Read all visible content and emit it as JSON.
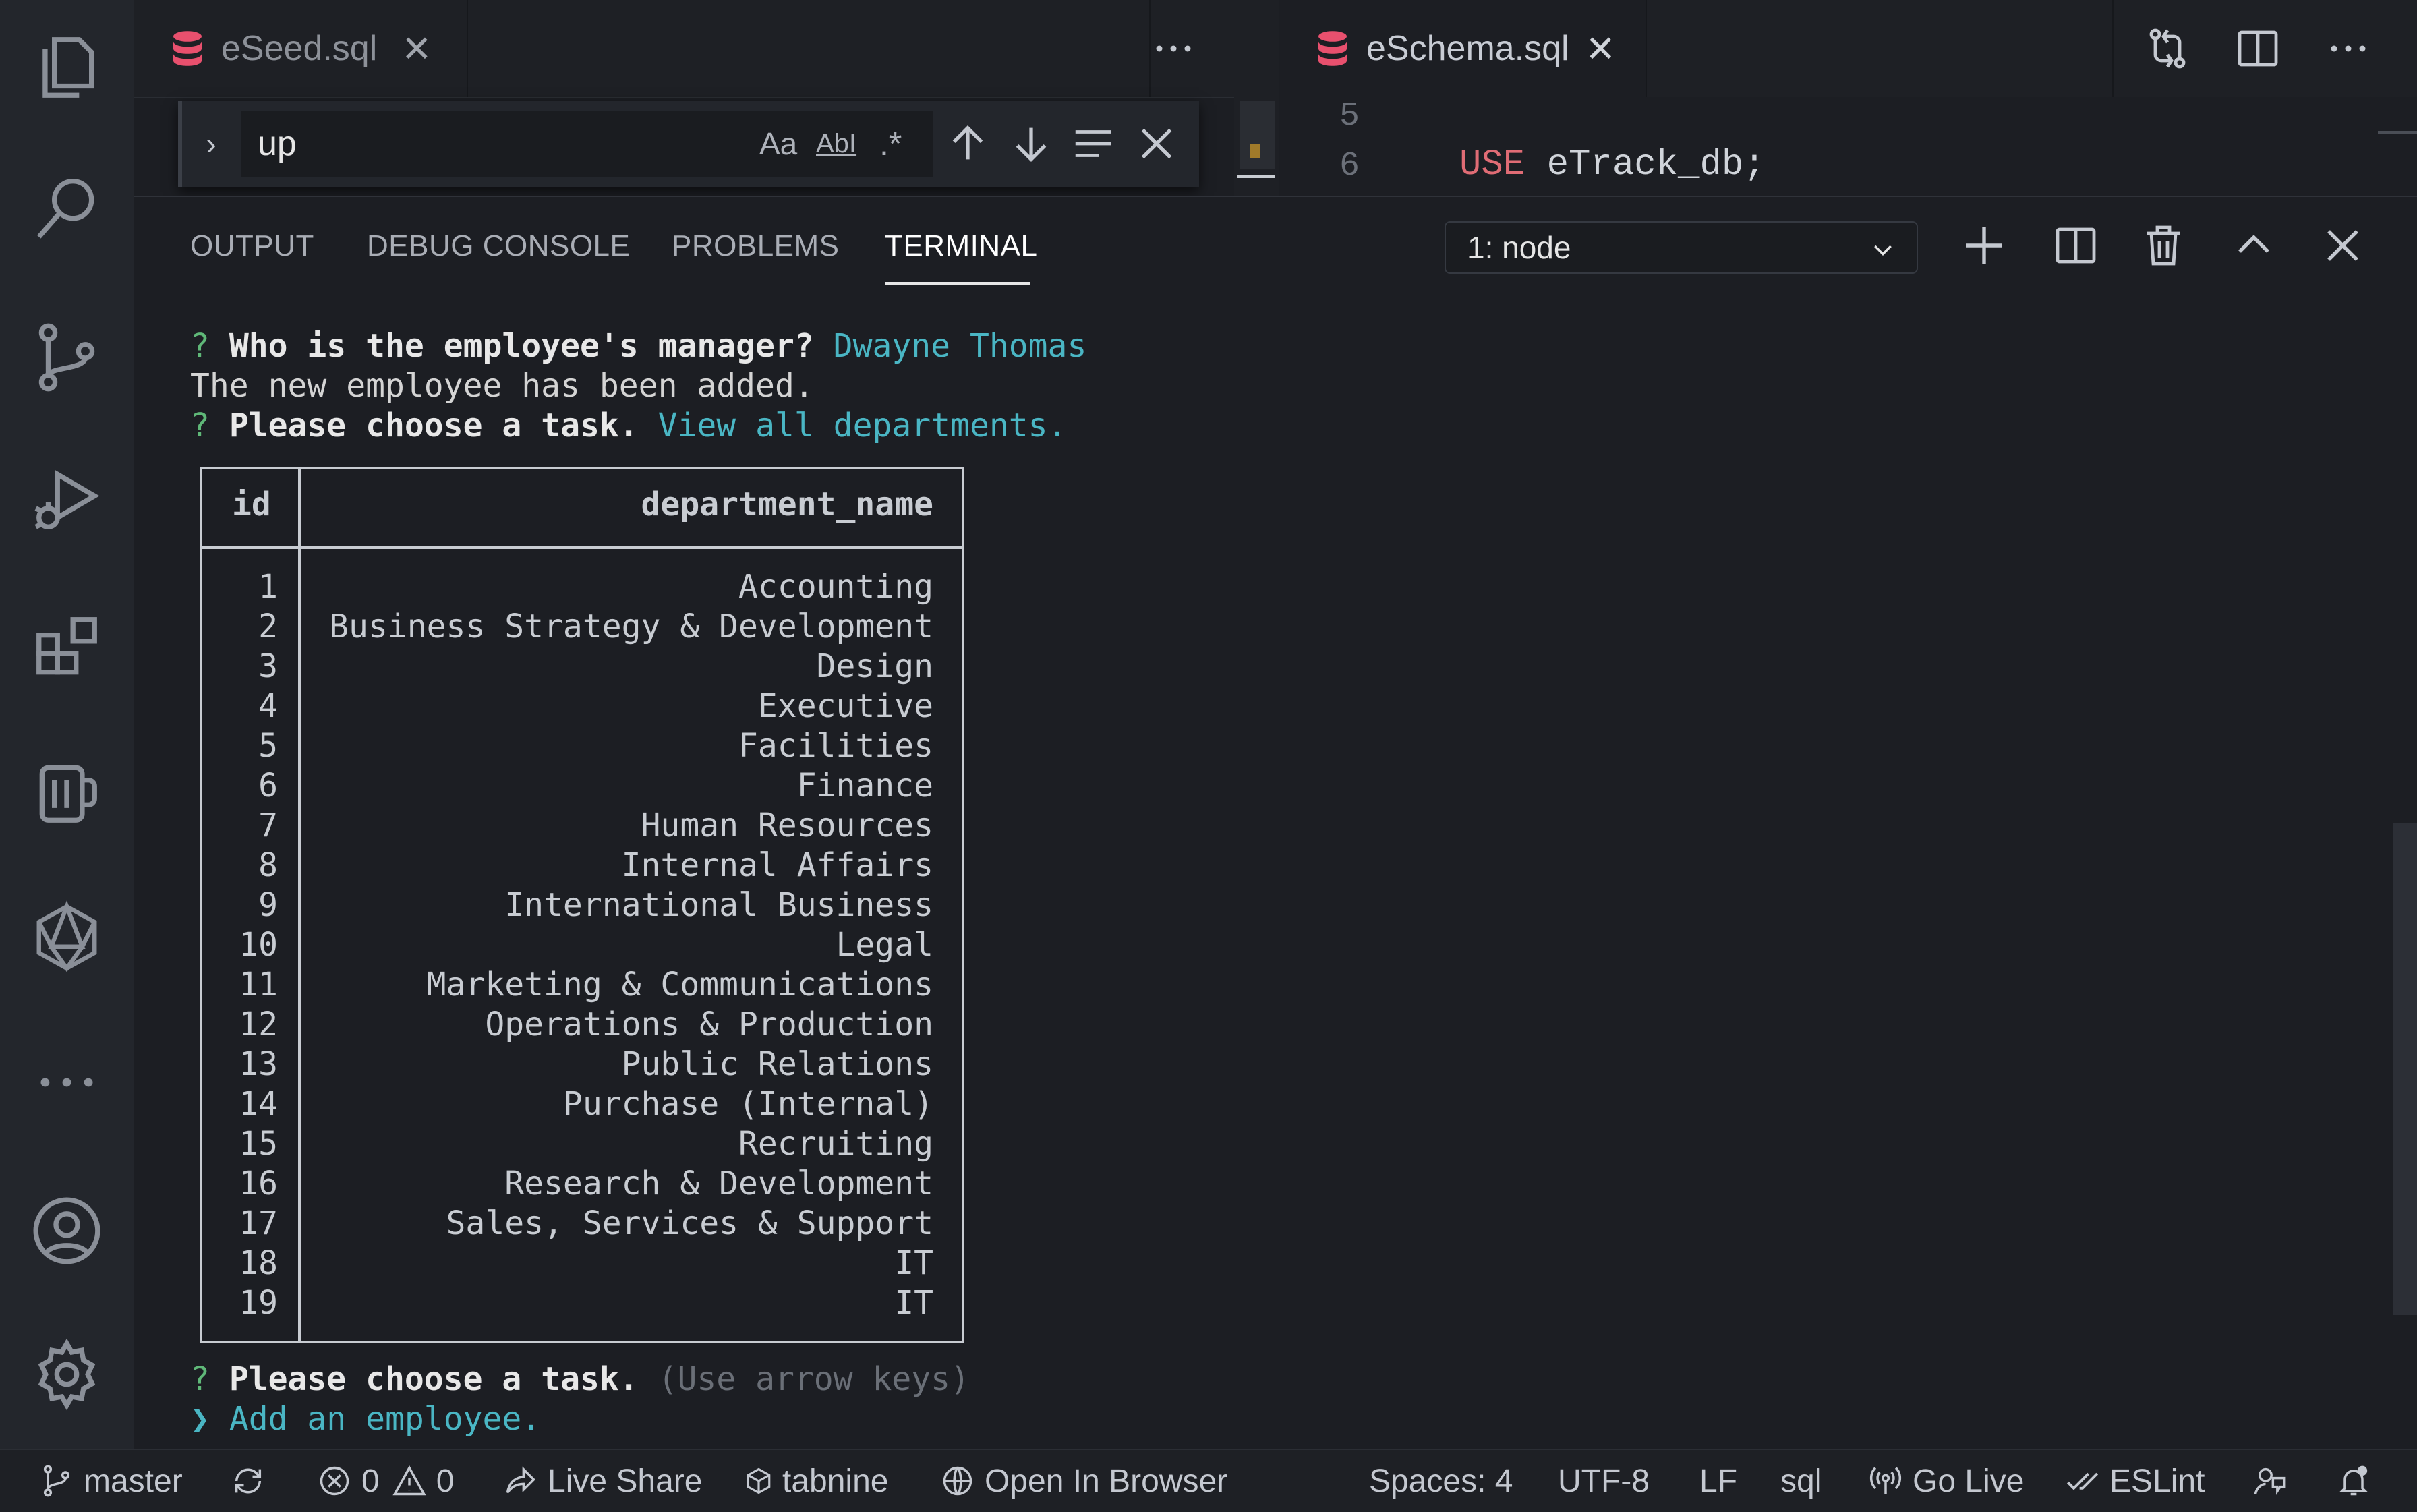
{
  "tabs": {
    "left": {
      "label": "eSeed.sql"
    },
    "right": {
      "label": "eSchema.sql"
    },
    "more_label": "···"
  },
  "find": {
    "value": "up",
    "match_case": "Aa",
    "whole_word": "AbI",
    "regex": ".*"
  },
  "editor": {
    "lines": [
      {
        "num": "5",
        "keyword": "",
        "text": ""
      },
      {
        "num": "6",
        "keyword": "USE",
        "text": " eTrack_db;"
      }
    ]
  },
  "panel": {
    "tabs": [
      "OUTPUT",
      "DEBUG CONSOLE",
      "PROBLEMS",
      "TERMINAL"
    ],
    "active_tab": "TERMINAL",
    "terminal_select": "1: node"
  },
  "terminal": {
    "line1": {
      "prefix": "?",
      "question": "Who is the employee's manager?",
      "answer": "Dwayne Thomas"
    },
    "line2": "The new employee has been added.",
    "line3": {
      "prefix": "?",
      "question": "Please choose a task.",
      "answer": "View all departments."
    },
    "table": {
      "headers": [
        "id",
        "department_name"
      ],
      "rows": [
        [
          "1",
          "Accounting"
        ],
        [
          "2",
          "Business Strategy & Development"
        ],
        [
          "3",
          "Design"
        ],
        [
          "4",
          "Executive"
        ],
        [
          "5",
          "Facilities"
        ],
        [
          "6",
          "Finance"
        ],
        [
          "7",
          "Human Resources"
        ],
        [
          "8",
          "Internal Affairs"
        ],
        [
          "9",
          "International Business"
        ],
        [
          "10",
          "Legal"
        ],
        [
          "11",
          "Marketing & Communications"
        ],
        [
          "12",
          "Operations & Production"
        ],
        [
          "13",
          "Public Relations"
        ],
        [
          "14",
          "Purchase (Internal)"
        ],
        [
          "15",
          "Recruiting"
        ],
        [
          "16",
          "Research & Development"
        ],
        [
          "17",
          "Sales, Services & Support"
        ],
        [
          "18",
          "IT"
        ],
        [
          "19",
          "IT"
        ]
      ]
    },
    "prompt": {
      "prefix": "?",
      "question": "Please choose a task.",
      "hint": "(Use arrow keys)"
    },
    "selected_choice": {
      "pointer": "❯",
      "label": "Add an employee."
    }
  },
  "statusbar": {
    "branch": "master",
    "errors": "0",
    "warnings": "0",
    "live_share": "Live Share",
    "tabnine": "tabnine",
    "open_in_browser": "Open In Browser",
    "spaces": "Spaces: 4",
    "encoding": "UTF-8",
    "eol": "LF",
    "language": "sql",
    "go_live": "Go Live",
    "eslint": "ESLint"
  },
  "colors": {
    "keyword": "#e06c75",
    "answer": "#4ab6c4",
    "prompt_mark": "#5fb878",
    "db_icon": "#e8506e"
  },
  "icons": [
    "files-icon",
    "search-icon",
    "source-control-icon",
    "run-debug-icon",
    "extensions-icon",
    "database-mug-icon",
    "polyhedron-icon",
    "more-icon",
    "account-icon",
    "settings-gear-icon"
  ]
}
